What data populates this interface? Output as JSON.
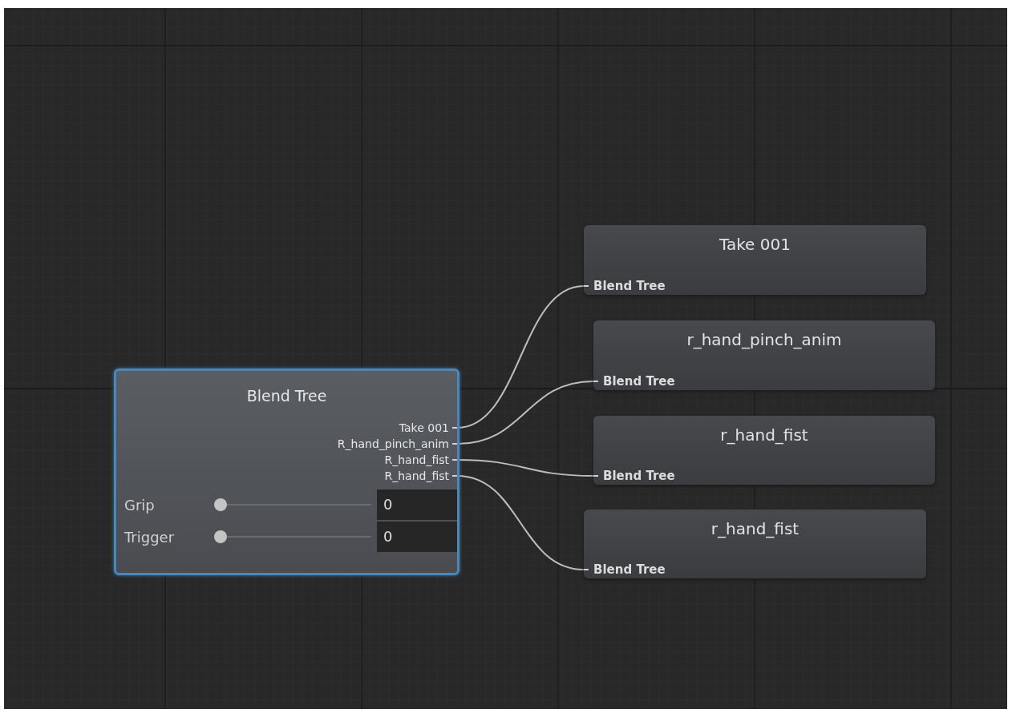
{
  "graph": {
    "blend_tree": {
      "title": "Blend Tree",
      "selected": true,
      "outputs": [
        {
          "label": "Take 001"
        },
        {
          "label": "R_hand_pinch_anim"
        },
        {
          "label": "R_hand_fist"
        },
        {
          "label": "R_hand_fist"
        }
      ],
      "parameters": [
        {
          "name": "Grip",
          "level": 0,
          "value": "0"
        },
        {
          "name": "Trigger",
          "level": 0,
          "value": "0"
        }
      ]
    },
    "clips": [
      {
        "title": "Take 001",
        "input": "Blend Tree"
      },
      {
        "title": "r_hand_pinch_anim",
        "input": "Blend Tree"
      },
      {
        "title": "r_hand_fist",
        "input": "Blend Tree"
      },
      {
        "title": "r_hand_fist",
        "input": "Blend Tree"
      }
    ]
  }
}
